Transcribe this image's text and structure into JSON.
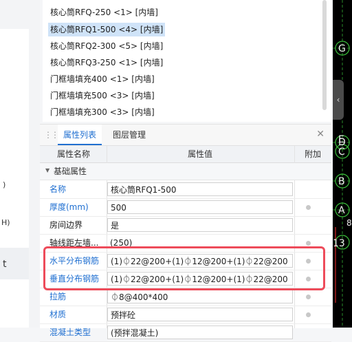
{
  "left_fragments": [
    ")",
    "H)",
    "t"
  ],
  "component_list": [
    "核心筒RFQ-250 <1> [内墙]",
    "核心筒RFQ1-500 <4> [内墙]",
    "核心筒RFQ2-300 <5> [内墙]",
    "核心筒RFQ3-250 <1> [内墙]",
    "门框墙填充400 <1> [内墙]",
    "门框墙填充500 <3> [内墙]",
    "门框墙填充300 <3> [内墙]"
  ],
  "selected_index": 1,
  "tabs": {
    "active": "属性列表",
    "inactive": "图层管理"
  },
  "table_headers": {
    "name": "属性名称",
    "value": "属性值",
    "extra": "附加"
  },
  "group": {
    "label": "基础属性"
  },
  "properties": [
    {
      "name": "名称",
      "value": "核心筒RFQ1-500",
      "blue": true,
      "dot": false
    },
    {
      "name": "厚度(mm)",
      "value": "500",
      "blue": true,
      "dot": true
    },
    {
      "name": "房间边界",
      "value": "是",
      "blue": false,
      "dot": false
    },
    {
      "name": "轴线距左墙...",
      "value": "(250)",
      "blue": false,
      "dot": true
    },
    {
      "name": "水平分布钢筋",
      "value": "(1)⏀22@200+(1)⏀12@200+(1)⏀22@200",
      "blue": true,
      "dot": true
    },
    {
      "name": "垂直分布钢筋",
      "value": "(1)⏀22@200+(1)⏀12@200+(1)⏀22@200",
      "blue": true,
      "dot": true
    },
    {
      "name": "拉筋",
      "value": "⏀8@400*400",
      "blue": true,
      "dot": true
    },
    {
      "name": "材质",
      "value": "预拌砼",
      "blue": true,
      "dot": true
    },
    {
      "name": "混凝土类型",
      "value": "(预拌混凝土)",
      "blue": true,
      "dot": false
    }
  ],
  "cad_labels": [
    "G",
    "E",
    "D",
    "C",
    "B",
    "A",
    "13",
    "8"
  ],
  "colors": {
    "accent": "#1f6fd1",
    "highlight": "#ee4b5a",
    "selected": "#cfe3f8"
  }
}
